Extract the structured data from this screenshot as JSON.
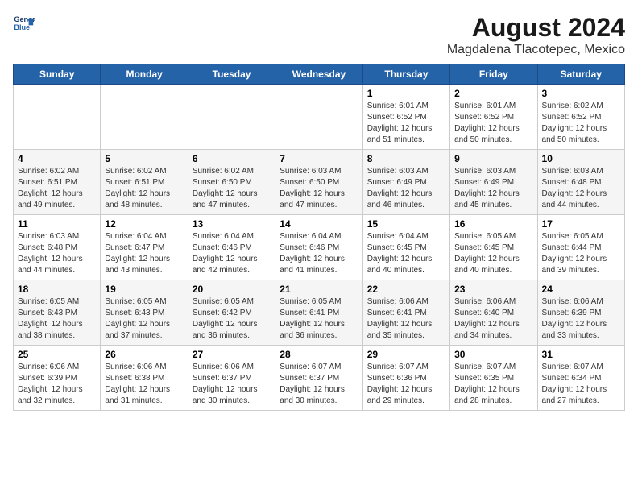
{
  "header": {
    "title": "August 2024",
    "subtitle": "Magdalena Tlacotepec, Mexico",
    "logo_line1": "General",
    "logo_line2": "Blue"
  },
  "days_of_week": [
    "Sunday",
    "Monday",
    "Tuesday",
    "Wednesday",
    "Thursday",
    "Friday",
    "Saturday"
  ],
  "weeks": [
    [
      {
        "day": "",
        "info": ""
      },
      {
        "day": "",
        "info": ""
      },
      {
        "day": "",
        "info": ""
      },
      {
        "day": "",
        "info": ""
      },
      {
        "day": "1",
        "info": "Sunrise: 6:01 AM\nSunset: 6:52 PM\nDaylight: 12 hours\nand 51 minutes."
      },
      {
        "day": "2",
        "info": "Sunrise: 6:01 AM\nSunset: 6:52 PM\nDaylight: 12 hours\nand 50 minutes."
      },
      {
        "day": "3",
        "info": "Sunrise: 6:02 AM\nSunset: 6:52 PM\nDaylight: 12 hours\nand 50 minutes."
      }
    ],
    [
      {
        "day": "4",
        "info": "Sunrise: 6:02 AM\nSunset: 6:51 PM\nDaylight: 12 hours\nand 49 minutes."
      },
      {
        "day": "5",
        "info": "Sunrise: 6:02 AM\nSunset: 6:51 PM\nDaylight: 12 hours\nand 48 minutes."
      },
      {
        "day": "6",
        "info": "Sunrise: 6:02 AM\nSunset: 6:50 PM\nDaylight: 12 hours\nand 47 minutes."
      },
      {
        "day": "7",
        "info": "Sunrise: 6:03 AM\nSunset: 6:50 PM\nDaylight: 12 hours\nand 47 minutes."
      },
      {
        "day": "8",
        "info": "Sunrise: 6:03 AM\nSunset: 6:49 PM\nDaylight: 12 hours\nand 46 minutes."
      },
      {
        "day": "9",
        "info": "Sunrise: 6:03 AM\nSunset: 6:49 PM\nDaylight: 12 hours\nand 45 minutes."
      },
      {
        "day": "10",
        "info": "Sunrise: 6:03 AM\nSunset: 6:48 PM\nDaylight: 12 hours\nand 44 minutes."
      }
    ],
    [
      {
        "day": "11",
        "info": "Sunrise: 6:03 AM\nSunset: 6:48 PM\nDaylight: 12 hours\nand 44 minutes."
      },
      {
        "day": "12",
        "info": "Sunrise: 6:04 AM\nSunset: 6:47 PM\nDaylight: 12 hours\nand 43 minutes."
      },
      {
        "day": "13",
        "info": "Sunrise: 6:04 AM\nSunset: 6:46 PM\nDaylight: 12 hours\nand 42 minutes."
      },
      {
        "day": "14",
        "info": "Sunrise: 6:04 AM\nSunset: 6:46 PM\nDaylight: 12 hours\nand 41 minutes."
      },
      {
        "day": "15",
        "info": "Sunrise: 6:04 AM\nSunset: 6:45 PM\nDaylight: 12 hours\nand 40 minutes."
      },
      {
        "day": "16",
        "info": "Sunrise: 6:05 AM\nSunset: 6:45 PM\nDaylight: 12 hours\nand 40 minutes."
      },
      {
        "day": "17",
        "info": "Sunrise: 6:05 AM\nSunset: 6:44 PM\nDaylight: 12 hours\nand 39 minutes."
      }
    ],
    [
      {
        "day": "18",
        "info": "Sunrise: 6:05 AM\nSunset: 6:43 PM\nDaylight: 12 hours\nand 38 minutes."
      },
      {
        "day": "19",
        "info": "Sunrise: 6:05 AM\nSunset: 6:43 PM\nDaylight: 12 hours\nand 37 minutes."
      },
      {
        "day": "20",
        "info": "Sunrise: 6:05 AM\nSunset: 6:42 PM\nDaylight: 12 hours\nand 36 minutes."
      },
      {
        "day": "21",
        "info": "Sunrise: 6:05 AM\nSunset: 6:41 PM\nDaylight: 12 hours\nand 36 minutes."
      },
      {
        "day": "22",
        "info": "Sunrise: 6:06 AM\nSunset: 6:41 PM\nDaylight: 12 hours\nand 35 minutes."
      },
      {
        "day": "23",
        "info": "Sunrise: 6:06 AM\nSunset: 6:40 PM\nDaylight: 12 hours\nand 34 minutes."
      },
      {
        "day": "24",
        "info": "Sunrise: 6:06 AM\nSunset: 6:39 PM\nDaylight: 12 hours\nand 33 minutes."
      }
    ],
    [
      {
        "day": "25",
        "info": "Sunrise: 6:06 AM\nSunset: 6:39 PM\nDaylight: 12 hours\nand 32 minutes."
      },
      {
        "day": "26",
        "info": "Sunrise: 6:06 AM\nSunset: 6:38 PM\nDaylight: 12 hours\nand 31 minutes."
      },
      {
        "day": "27",
        "info": "Sunrise: 6:06 AM\nSunset: 6:37 PM\nDaylight: 12 hours\nand 30 minutes."
      },
      {
        "day": "28",
        "info": "Sunrise: 6:07 AM\nSunset: 6:37 PM\nDaylight: 12 hours\nand 30 minutes."
      },
      {
        "day": "29",
        "info": "Sunrise: 6:07 AM\nSunset: 6:36 PM\nDaylight: 12 hours\nand 29 minutes."
      },
      {
        "day": "30",
        "info": "Sunrise: 6:07 AM\nSunset: 6:35 PM\nDaylight: 12 hours\nand 28 minutes."
      },
      {
        "day": "31",
        "info": "Sunrise: 6:07 AM\nSunset: 6:34 PM\nDaylight: 12 hours\nand 27 minutes."
      }
    ]
  ]
}
